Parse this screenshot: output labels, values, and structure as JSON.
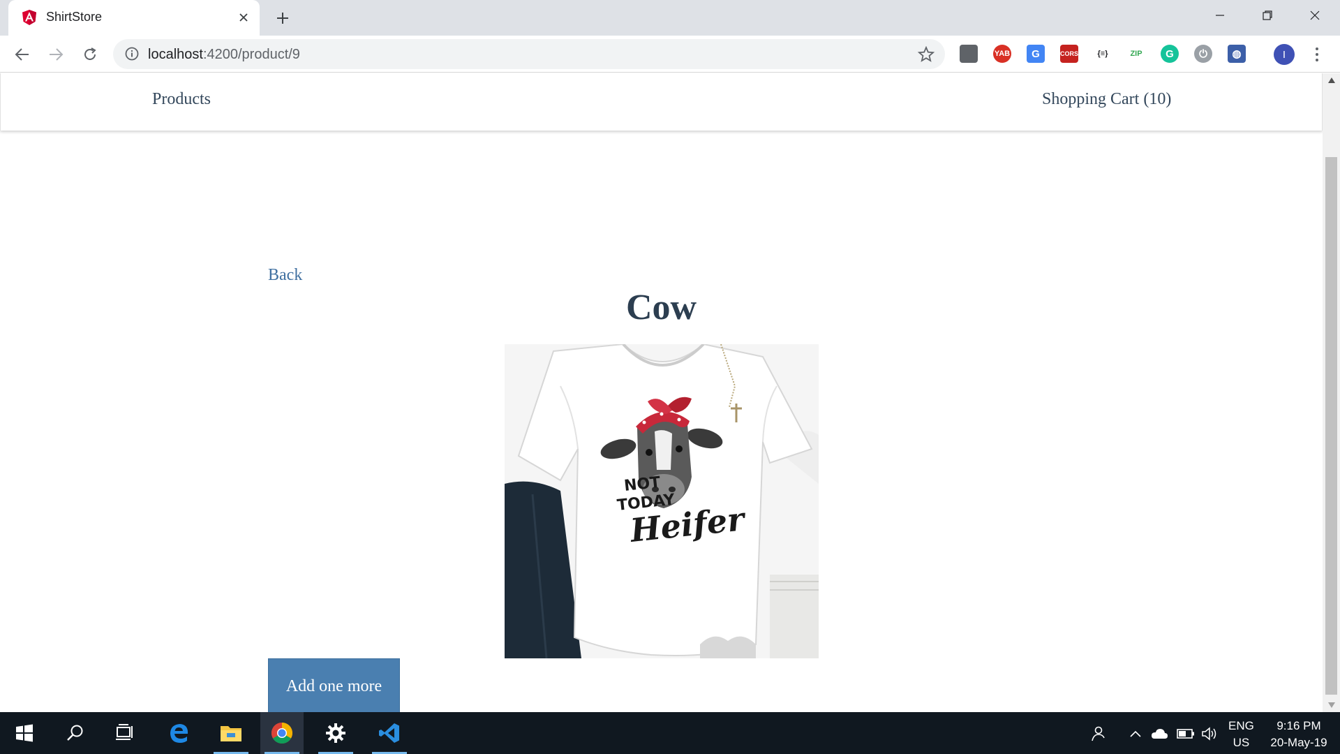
{
  "browser": {
    "tab_title": "ShirtStore",
    "url_host": "localhost",
    "url_path": ":4200/product/9",
    "extensions": [
      {
        "name": "ext-dark",
        "label": "",
        "color": "#5f6368"
      },
      {
        "name": "ext-yab",
        "label": "YAB",
        "color": "#d93025"
      },
      {
        "name": "ext-google-translate",
        "label": "G",
        "color": "#4285f4"
      },
      {
        "name": "ext-cors",
        "label": "CORS",
        "color": "#c5221f"
      },
      {
        "name": "ext-json",
        "label": "{≡}",
        "color": "#202124"
      },
      {
        "name": "ext-zip",
        "label": "ZIP",
        "color": "#34a853"
      },
      {
        "name": "ext-grammarly",
        "label": "G",
        "color": "#15c39a"
      },
      {
        "name": "ext-power",
        "label": "⏻",
        "color": "#9aa0a6"
      },
      {
        "name": "ext-globe",
        "label": "◍",
        "color": "#3c5fa8"
      }
    ],
    "profile_initial": "I"
  },
  "site": {
    "nav": {
      "products": "Products",
      "cart": "Shopping Cart (10)"
    },
    "back": "Back",
    "product": {
      "title": "Cow",
      "shirt_text_1": "NOT",
      "shirt_text_2": "TODAY",
      "shirt_text_3": "Heifer"
    },
    "add_button": "Add one more"
  },
  "taskbar": {
    "lang_top": "ENG",
    "lang_bottom": "US",
    "time": "9:16 PM",
    "date": "20-May-19"
  },
  "colors": {
    "link": "#3f6fa0",
    "button": "#4a7fb0",
    "title": "#2c3e50",
    "angular_red": "#dd0031"
  }
}
